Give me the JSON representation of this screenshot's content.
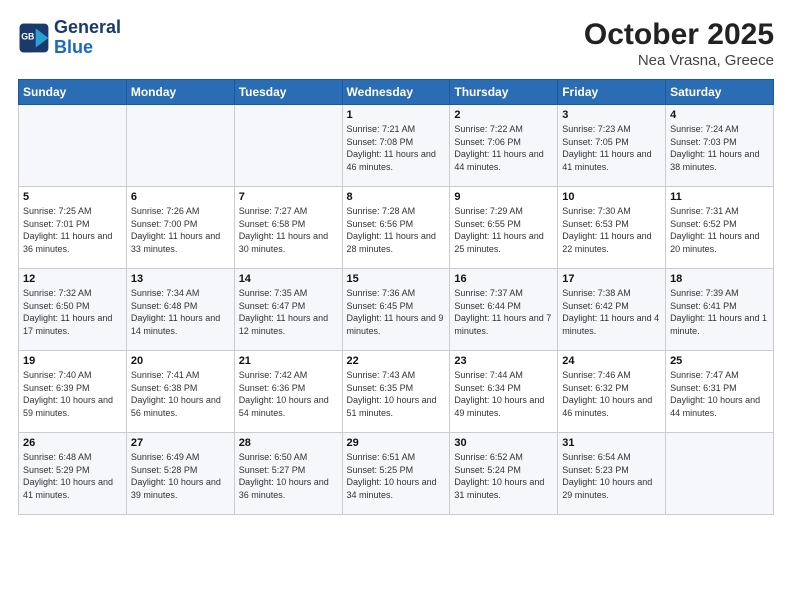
{
  "header": {
    "logo_line1": "General",
    "logo_line2": "Blue",
    "title": "October 2025",
    "subtitle": "Nea Vrasna, Greece"
  },
  "columns": [
    "Sunday",
    "Monday",
    "Tuesday",
    "Wednesday",
    "Thursday",
    "Friday",
    "Saturday"
  ],
  "weeks": [
    [
      {
        "day": "",
        "info": ""
      },
      {
        "day": "",
        "info": ""
      },
      {
        "day": "",
        "info": ""
      },
      {
        "day": "1",
        "info": "Sunrise: 7:21 AM\nSunset: 7:08 PM\nDaylight: 11 hours and 46 minutes."
      },
      {
        "day": "2",
        "info": "Sunrise: 7:22 AM\nSunset: 7:06 PM\nDaylight: 11 hours and 44 minutes."
      },
      {
        "day": "3",
        "info": "Sunrise: 7:23 AM\nSunset: 7:05 PM\nDaylight: 11 hours and 41 minutes."
      },
      {
        "day": "4",
        "info": "Sunrise: 7:24 AM\nSunset: 7:03 PM\nDaylight: 11 hours and 38 minutes."
      }
    ],
    [
      {
        "day": "5",
        "info": "Sunrise: 7:25 AM\nSunset: 7:01 PM\nDaylight: 11 hours and 36 minutes."
      },
      {
        "day": "6",
        "info": "Sunrise: 7:26 AM\nSunset: 7:00 PM\nDaylight: 11 hours and 33 minutes."
      },
      {
        "day": "7",
        "info": "Sunrise: 7:27 AM\nSunset: 6:58 PM\nDaylight: 11 hours and 30 minutes."
      },
      {
        "day": "8",
        "info": "Sunrise: 7:28 AM\nSunset: 6:56 PM\nDaylight: 11 hours and 28 minutes."
      },
      {
        "day": "9",
        "info": "Sunrise: 7:29 AM\nSunset: 6:55 PM\nDaylight: 11 hours and 25 minutes."
      },
      {
        "day": "10",
        "info": "Sunrise: 7:30 AM\nSunset: 6:53 PM\nDaylight: 11 hours and 22 minutes."
      },
      {
        "day": "11",
        "info": "Sunrise: 7:31 AM\nSunset: 6:52 PM\nDaylight: 11 hours and 20 minutes."
      }
    ],
    [
      {
        "day": "12",
        "info": "Sunrise: 7:32 AM\nSunset: 6:50 PM\nDaylight: 11 hours and 17 minutes."
      },
      {
        "day": "13",
        "info": "Sunrise: 7:34 AM\nSunset: 6:48 PM\nDaylight: 11 hours and 14 minutes."
      },
      {
        "day": "14",
        "info": "Sunrise: 7:35 AM\nSunset: 6:47 PM\nDaylight: 11 hours and 12 minutes."
      },
      {
        "day": "15",
        "info": "Sunrise: 7:36 AM\nSunset: 6:45 PM\nDaylight: 11 hours and 9 minutes."
      },
      {
        "day": "16",
        "info": "Sunrise: 7:37 AM\nSunset: 6:44 PM\nDaylight: 11 hours and 7 minutes."
      },
      {
        "day": "17",
        "info": "Sunrise: 7:38 AM\nSunset: 6:42 PM\nDaylight: 11 hours and 4 minutes."
      },
      {
        "day": "18",
        "info": "Sunrise: 7:39 AM\nSunset: 6:41 PM\nDaylight: 11 hours and 1 minute."
      }
    ],
    [
      {
        "day": "19",
        "info": "Sunrise: 7:40 AM\nSunset: 6:39 PM\nDaylight: 10 hours and 59 minutes."
      },
      {
        "day": "20",
        "info": "Sunrise: 7:41 AM\nSunset: 6:38 PM\nDaylight: 10 hours and 56 minutes."
      },
      {
        "day": "21",
        "info": "Sunrise: 7:42 AM\nSunset: 6:36 PM\nDaylight: 10 hours and 54 minutes."
      },
      {
        "day": "22",
        "info": "Sunrise: 7:43 AM\nSunset: 6:35 PM\nDaylight: 10 hours and 51 minutes."
      },
      {
        "day": "23",
        "info": "Sunrise: 7:44 AM\nSunset: 6:34 PM\nDaylight: 10 hours and 49 minutes."
      },
      {
        "day": "24",
        "info": "Sunrise: 7:46 AM\nSunset: 6:32 PM\nDaylight: 10 hours and 46 minutes."
      },
      {
        "day": "25",
        "info": "Sunrise: 7:47 AM\nSunset: 6:31 PM\nDaylight: 10 hours and 44 minutes."
      }
    ],
    [
      {
        "day": "26",
        "info": "Sunrise: 6:48 AM\nSunset: 5:29 PM\nDaylight: 10 hours and 41 minutes."
      },
      {
        "day": "27",
        "info": "Sunrise: 6:49 AM\nSunset: 5:28 PM\nDaylight: 10 hours and 39 minutes."
      },
      {
        "day": "28",
        "info": "Sunrise: 6:50 AM\nSunset: 5:27 PM\nDaylight: 10 hours and 36 minutes."
      },
      {
        "day": "29",
        "info": "Sunrise: 6:51 AM\nSunset: 5:25 PM\nDaylight: 10 hours and 34 minutes."
      },
      {
        "day": "30",
        "info": "Sunrise: 6:52 AM\nSunset: 5:24 PM\nDaylight: 10 hours and 31 minutes."
      },
      {
        "day": "31",
        "info": "Sunrise: 6:54 AM\nSunset: 5:23 PM\nDaylight: 10 hours and 29 minutes."
      },
      {
        "day": "",
        "info": ""
      }
    ]
  ]
}
